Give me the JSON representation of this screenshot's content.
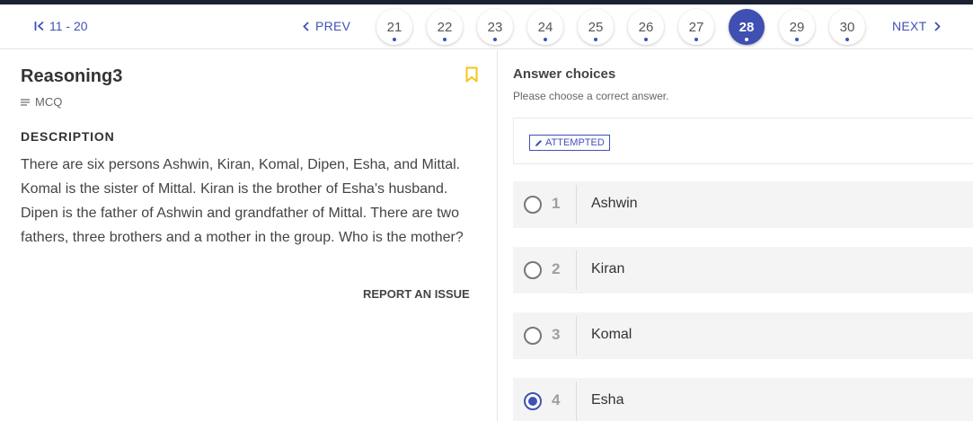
{
  "nav": {
    "range_label": "11 - 20",
    "prev_label": "PREV",
    "next_label": "NEXT",
    "pages": [
      "21",
      "22",
      "23",
      "24",
      "25",
      "26",
      "27",
      "28",
      "29",
      "30"
    ],
    "current_page": "28"
  },
  "question": {
    "title": "Reasoning3",
    "type": "MCQ",
    "description_heading": "DESCRIPTION",
    "description": "There are six persons Ashwin, Kiran, Komal, Dipen, Esha, and Mittal. Komal is the sister of Mittal. Kiran is the brother of Esha's husband. Dipen is the father of Ashwin and grandfather of Mittal. There are two fathers, three brothers and a mother in the group. Who is the mother?",
    "report_label": "REPORT AN ISSUE"
  },
  "answers": {
    "heading": "Answer choices",
    "subheading": "Please choose a correct answer.",
    "status": "ATTEMPTED",
    "options": [
      {
        "number": "1",
        "label": "Ashwin",
        "selected": false
      },
      {
        "number": "2",
        "label": "Kiran",
        "selected": false
      },
      {
        "number": "3",
        "label": "Komal",
        "selected": false
      },
      {
        "number": "4",
        "label": "Esha",
        "selected": true
      }
    ]
  },
  "colors": {
    "accent": "#3f51b5",
    "bookmark": "#f5c518",
    "topbar": "#1c2033"
  },
  "icons": {
    "first_page": "first-page-icon",
    "prev": "chevron-left-icon",
    "next": "chevron-right-icon",
    "bookmark": "bookmark-icon",
    "type": "list-icon",
    "edit": "pencil-icon"
  }
}
